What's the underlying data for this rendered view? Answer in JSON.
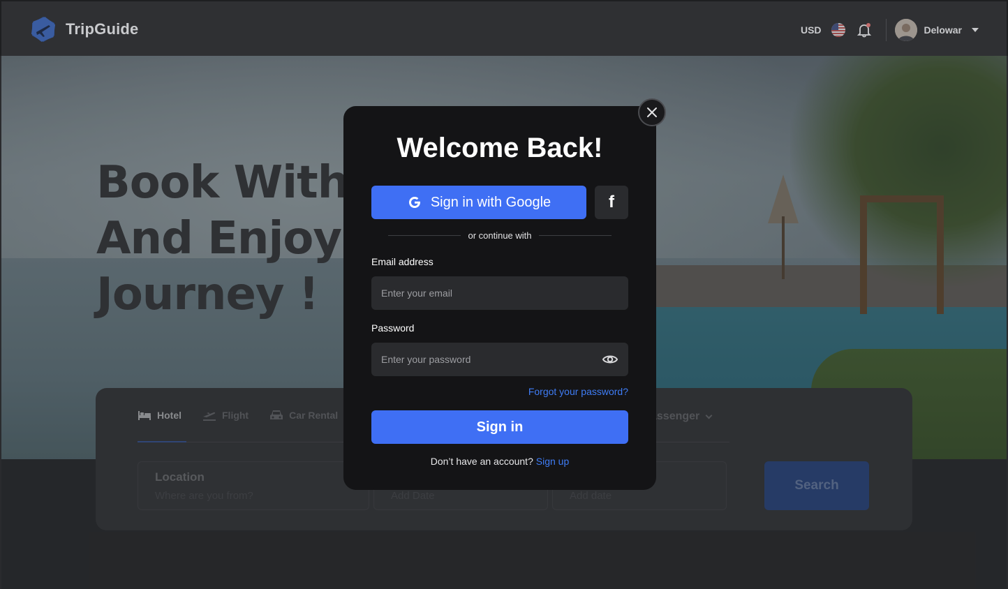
{
  "header": {
    "brand": "TripGuide",
    "currency": "USD",
    "user_name": "Delowar"
  },
  "hero": {
    "title_lines": [
      "Book With U",
      "And Enjoy y",
      "Journey !"
    ]
  },
  "booking": {
    "tabs": [
      {
        "label": "Hotel",
        "active": true
      },
      {
        "label": "Flight",
        "active": false
      },
      {
        "label": "Car Rental",
        "active": false
      }
    ],
    "passenger_label": "assenger",
    "fields": {
      "location_label": "Location",
      "location_placeholder": "Where are you from?",
      "checkin_placeholder": "Add Date",
      "checkout_placeholder": "Add date"
    },
    "search_label": "Search"
  },
  "modal": {
    "title": "Welcome Back!",
    "google_label": "Sign in with Google",
    "facebook_glyph": "f",
    "divider_text": "or continue with",
    "email_label": "Email address",
    "email_placeholder": "Enter your email",
    "password_label": "Password",
    "password_placeholder": "Enter your password",
    "forgot_label": "Forgot your password?",
    "signin_label": "Sign in",
    "no_account_text": "Don’t have an account?",
    "signup_label": "Sign up"
  },
  "colors": {
    "primary": "#3f6ff4",
    "link": "#3f7df6",
    "modal_bg": "#141416",
    "input_bg": "#2a2b2e"
  },
  "icons": [
    "airplane-logo-icon",
    "us-flag-icon",
    "bell-icon",
    "avatar",
    "caret-down-icon",
    "close-icon",
    "google-icon",
    "facebook-icon",
    "eye-icon",
    "bed-icon",
    "flight-icon",
    "car-icon",
    "chevron-down-icon"
  ]
}
